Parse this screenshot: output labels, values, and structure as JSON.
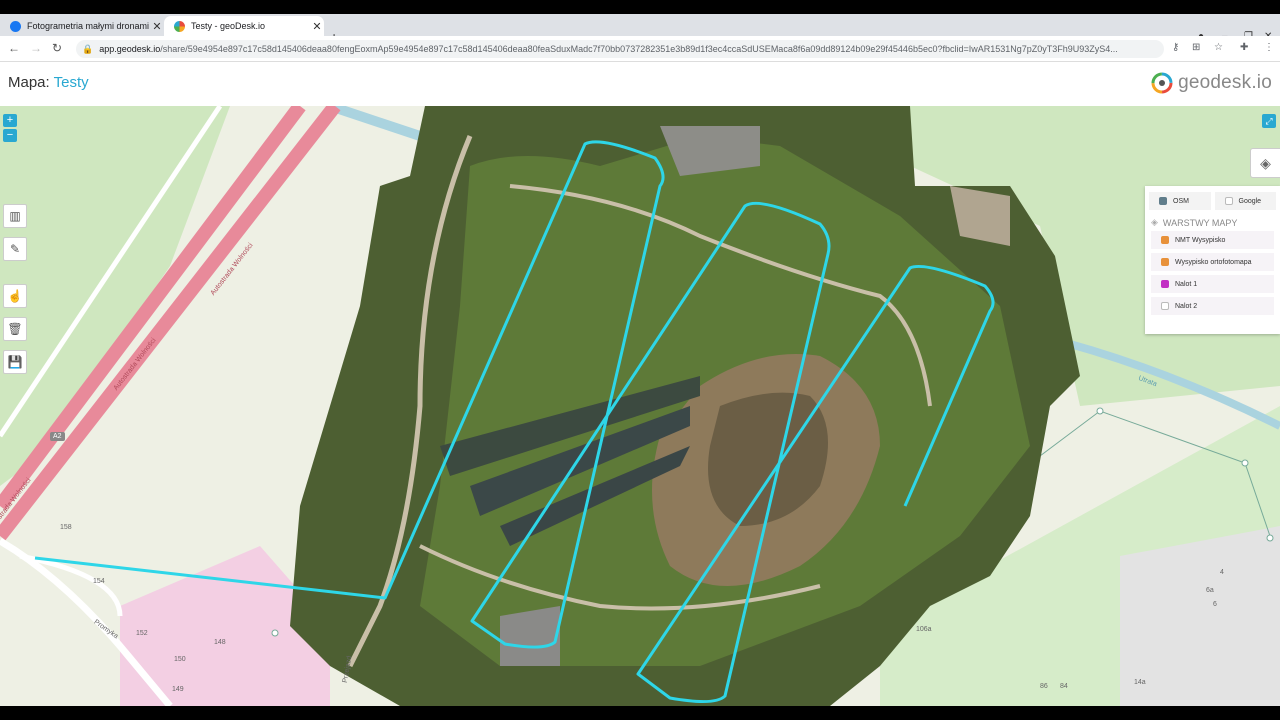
{
  "browser": {
    "tabs": [
      {
        "title": "Fotogrametria małymi dronami",
        "active": false,
        "favicon_color": "#1877f2"
      },
      {
        "title": "Testy - geoDesk.io",
        "active": true,
        "favicon_color": "#e94b3c"
      }
    ],
    "url_host": "app.geodesk.io",
    "url_path": "/share/59e4954e897c17c58d145406deaa80fengEoxmAp59e4954e897c17c58d145406deaa80feaSduxMadc7f70bb0737282351e3b89d1f3ec4ccaSdUSEMaca8f6a09dd89124b09e29f45446b5ec0?fbclid=IwAR1531Ng7pZ0yT3Fh9U93ZyS4..."
  },
  "app": {
    "map_label": "Mapa:",
    "map_name": "Testy",
    "logo_text": "geodesk.io"
  },
  "basemaps": [
    {
      "label": "OSM",
      "color": "#607d8b",
      "checked": true
    },
    {
      "label": "Google",
      "color": "#ffffff",
      "checked": false
    }
  ],
  "layers_header": "WARSTWY MAPY",
  "layers": [
    {
      "label": "NMT Wysypisko",
      "color": "#e8913a"
    },
    {
      "label": "Wysypisko ortofotomapa",
      "color": "#e8913a"
    },
    {
      "label": "Nalot 1",
      "color": "#c22fc4"
    },
    {
      "label": "Nalot 2",
      "color": "#ffffff"
    }
  ],
  "map_labels": {
    "road1": "Autostrada Wolności",
    "road2": "Autostrada Wolności",
    "road3": "Autostrada Wolności",
    "a2": "A2",
    "promyka": "Promyka",
    "przejazd": "Przejazd",
    "river": "Utrata",
    "n158": "158",
    "n154": "154",
    "n152": "152",
    "n148": "148",
    "n150": "150",
    "n149": "149",
    "n106a": "106a",
    "n86": "86",
    "n84": "84",
    "n14a": "14a",
    "n4": "4",
    "n6a": "6a",
    "n6": "6"
  },
  "colors": {
    "accent": "#29a8d1",
    "flight_path": "#2ed6e8",
    "road": "#e88a9a"
  }
}
